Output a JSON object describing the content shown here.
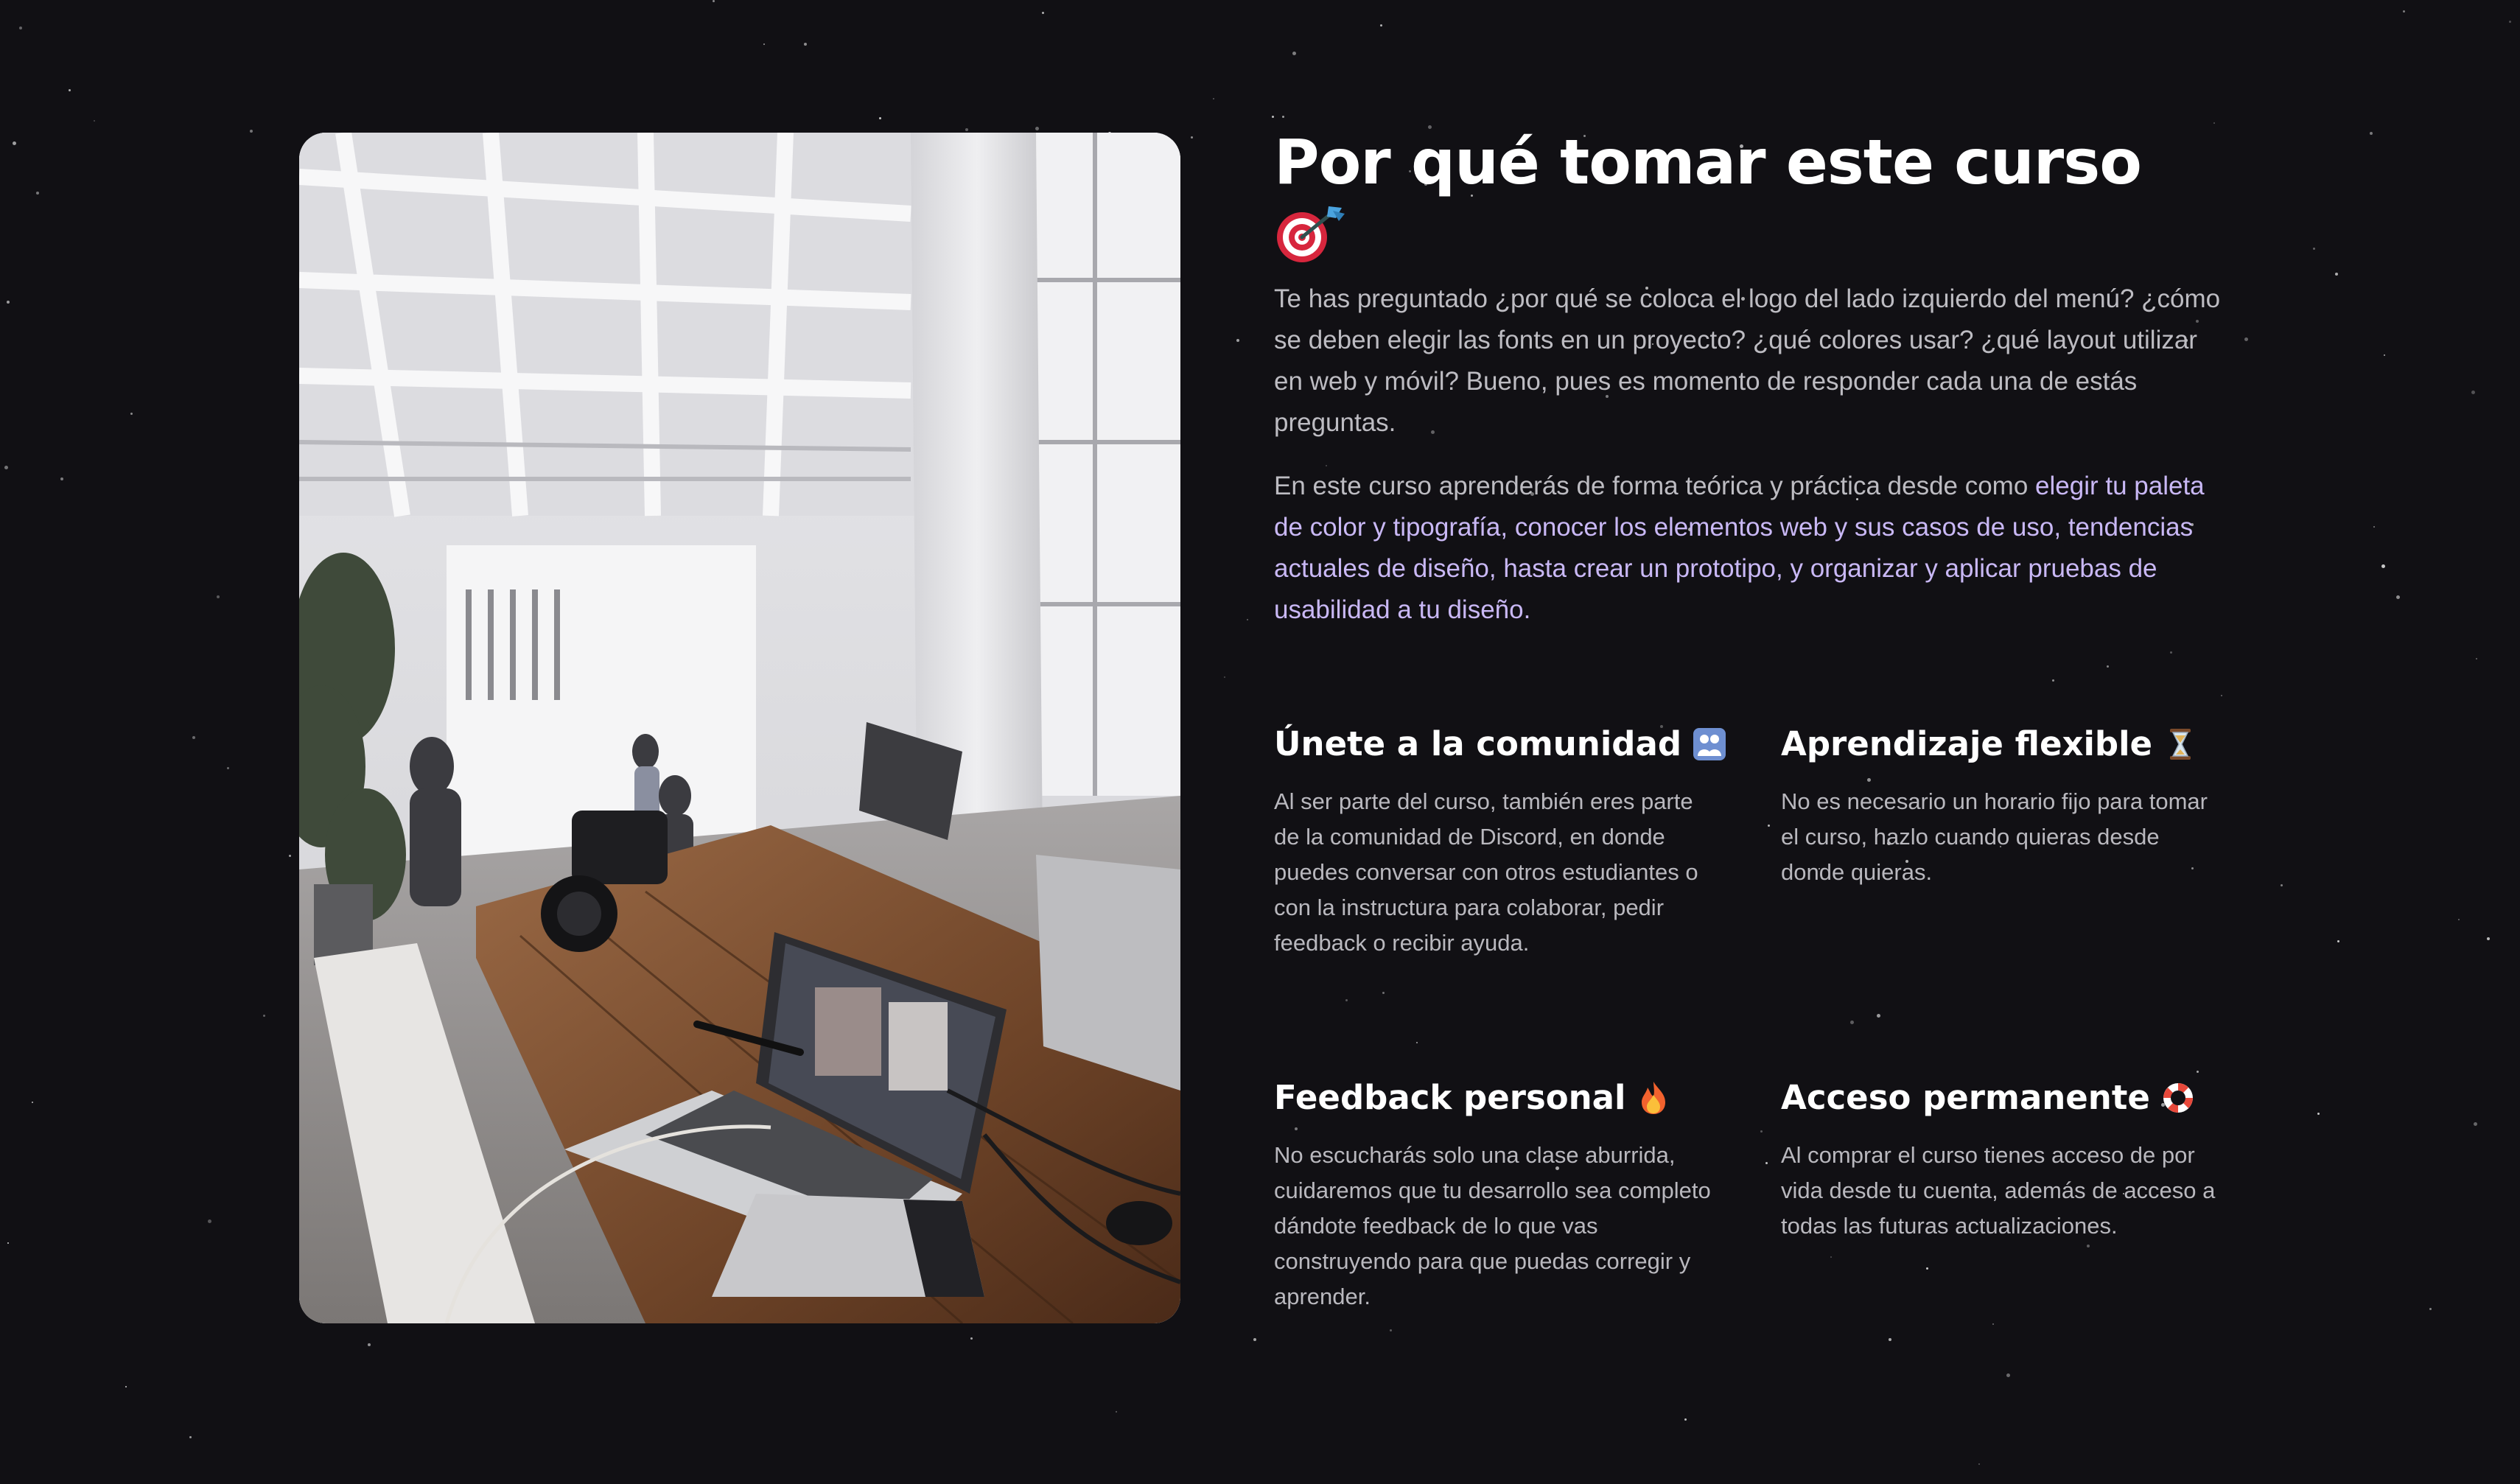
{
  "section": {
    "title": "Por qué tomar este curso",
    "title_icon": "target-dart-icon",
    "intro": "Te has preguntado ¿por qué se coloca el logo del lado izquierdo del menú? ¿cómo se deben elegir las fonts en un proyecto? ¿qué colores usar? ¿qué layout utilizar en web y móvil? Bueno, pues es momento de responder cada una de estás preguntas.",
    "course": {
      "lead": "En este curso aprenderás de forma teórica y práctica desde como ",
      "topic_1": "elegir tu paleta de color y tipografía",
      "sep_1": ", ",
      "topic_2": "conocer los elementos web y sus casos de uso",
      "sep_2": ", ",
      "topic_3": "tendencias actuales de diseño",
      "sep_3": ", ",
      "topic_4": "hasta crear un prototipo",
      "sep_4": ", ",
      "topic_5": "y organizar y aplicar pruebas de usabilidad a tu diseño",
      "end": "."
    },
    "accent_color": "#c9b8f5",
    "image_icon": "workspace-laptop-photo"
  },
  "features": [
    {
      "title": "Únete a la comunidad",
      "icon": "people-icon",
      "text": "Al ser parte del curso, también eres parte de la comunidad de Discord, en donde puedes conversar con otros estudiantes o con la instructura para colaborar, pedir feedback o recibir ayuda."
    },
    {
      "title": "Aprendizaje flexible",
      "icon": "hourglass-icon",
      "text": "No es necesario un horario fijo para tomar el curso, hazlo cuando quieras desde donde quieras."
    },
    {
      "title": "Feedback personal",
      "icon": "fire-icon",
      "text": "No escucharás solo una clase aburrida, cuidaremos que tu desarrollo sea completo dándote feedback de lo que vas construyendo para que puedas corregir y aprender."
    },
    {
      "title": "Acceso permanente",
      "icon": "lifebuoy-icon",
      "text": "Al comprar el curso tienes acceso de por vida desde tu cuenta, además de acceso a todas las futuras actualizaciones."
    }
  ]
}
